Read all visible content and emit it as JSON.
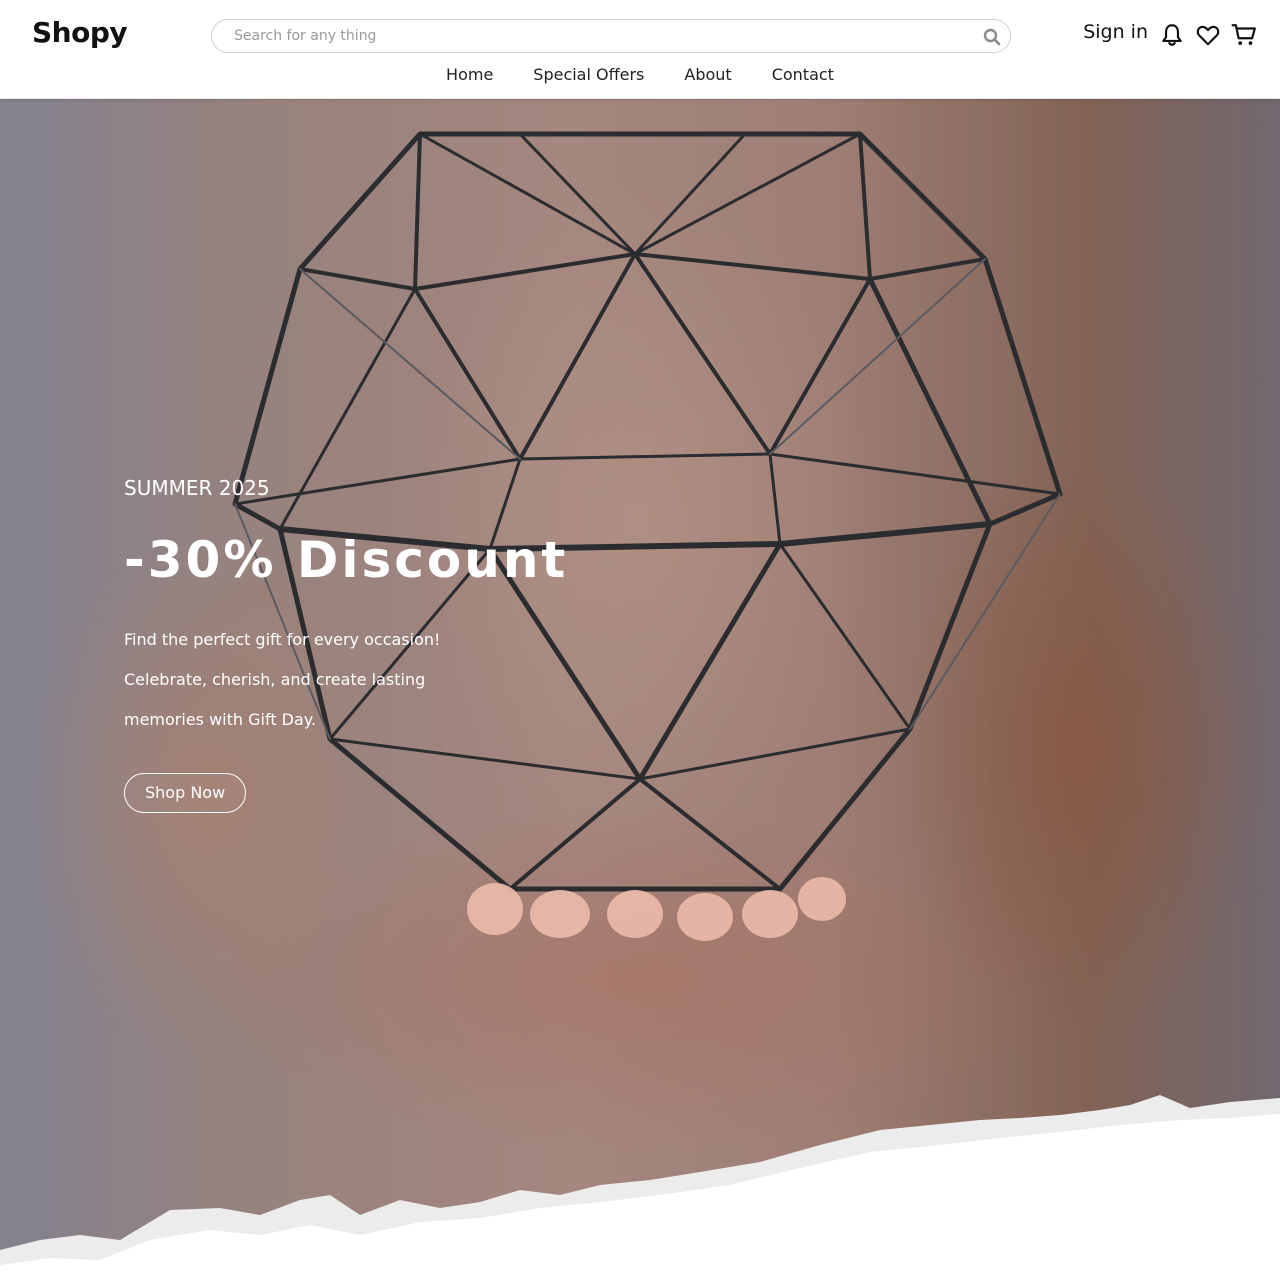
{
  "header": {
    "logo": "Shopy",
    "search_placeholder": "Search for any thing",
    "search_value": "",
    "nav": [
      {
        "label": "Home"
      },
      {
        "label": "Special Offers"
      },
      {
        "label": "About"
      },
      {
        "label": "Contact"
      }
    ],
    "sign_in": "Sign in",
    "icons": [
      "search-icon",
      "bell-icon",
      "heart-icon",
      "cart-icon"
    ]
  },
  "hero": {
    "season": "SUMMER 2025",
    "headline": "-30% Discount",
    "description": [
      "Find the perfect gift for every occasion!",
      "Celebrate, cherish, and create lasting",
      "memories with Gift Day."
    ],
    "cta_label": "Shop Now"
  },
  "colors": {
    "text_dark": "#111111",
    "hero_text": "#ffffff",
    "border": "#cfcfcf"
  }
}
